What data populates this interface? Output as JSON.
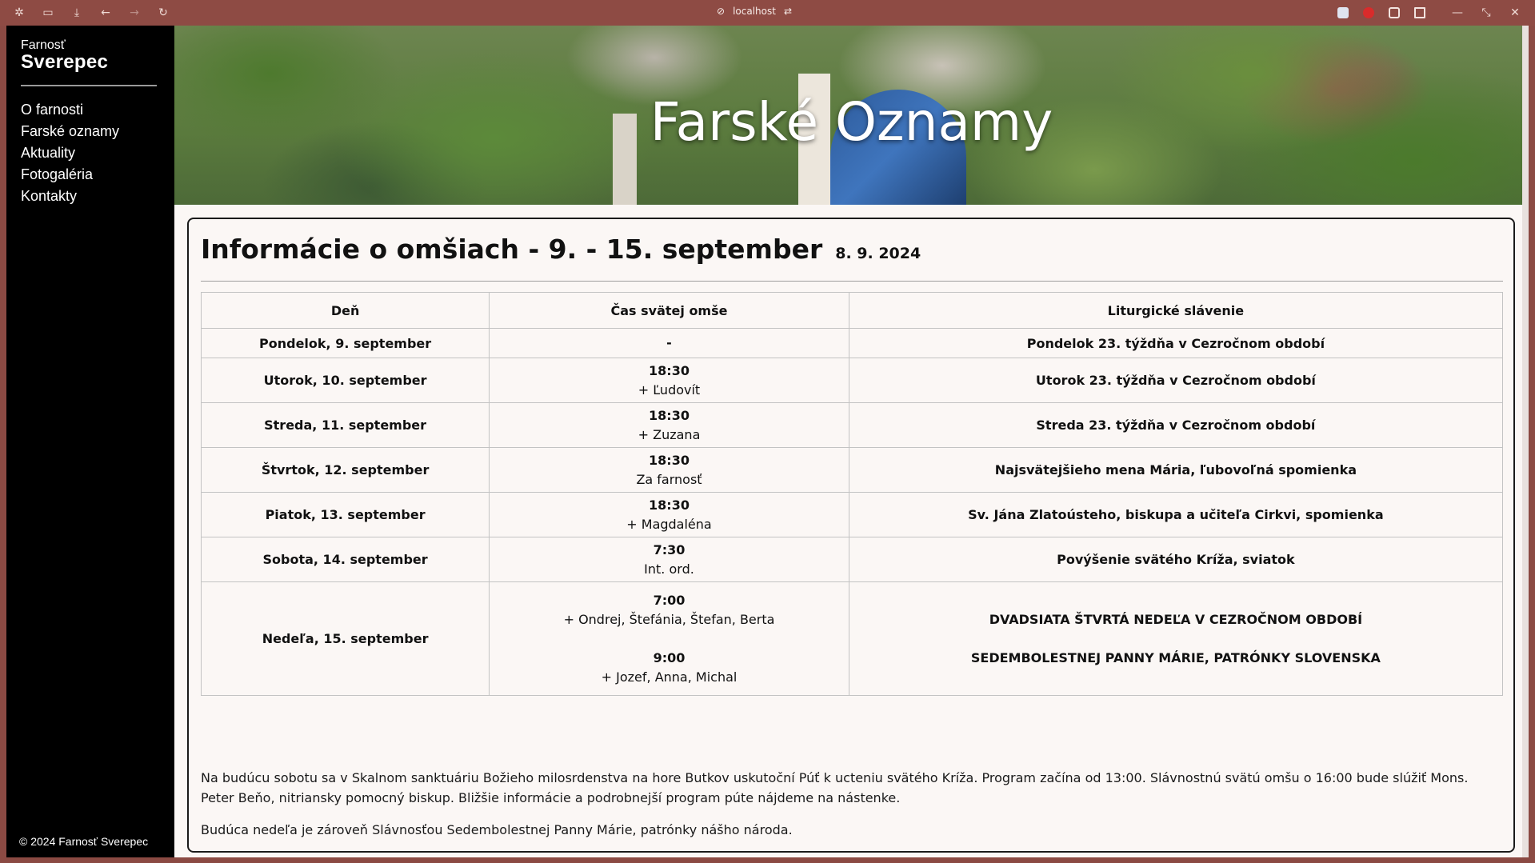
{
  "browser": {
    "url": "localhost"
  },
  "sidebar": {
    "brand_small": "Farnosť",
    "brand_big": "Sverepec",
    "nav": [
      "O farnosti",
      "Farské oznamy",
      "Aktuality",
      "Fotogaléria",
      "Kontakty"
    ],
    "copyright": "© 2024 Farnosť Sverepec"
  },
  "hero": {
    "title": "Farské Oznamy"
  },
  "content": {
    "title": "Informácie o omšiach - 9. - 15. september",
    "date": "8. 9. 2024",
    "table": {
      "headers": [
        "Deň",
        "Čas svätej omše",
        "Liturgické slávenie"
      ],
      "rows": [
        {
          "day": "Pondelok, 9. september",
          "masses": [
            {
              "time": "-",
              "intention": ""
            }
          ],
          "liturgy": [
            "Pondelok 23. týždňa v Cezročnom období"
          ]
        },
        {
          "day": "Utorok, 10. september",
          "masses": [
            {
              "time": "18:30",
              "intention": "+ Ľudovít"
            }
          ],
          "liturgy": [
            "Utorok 23. týždňa v Cezročnom období"
          ]
        },
        {
          "day": "Streda, 11. september",
          "masses": [
            {
              "time": "18:30",
              "intention": "+ Zuzana"
            }
          ],
          "liturgy": [
            "Streda 23. týždňa v Cezročnom období"
          ]
        },
        {
          "day": "Štvrtok, 12. september",
          "masses": [
            {
              "time": "18:30",
              "intention": "Za farnosť"
            }
          ],
          "liturgy": [
            "Najsvätejšieho mena Mária, ľubovoľná spomienka"
          ]
        },
        {
          "day": "Piatok, 13. september",
          "masses": [
            {
              "time": "18:30",
              "intention": "+ Magdaléna"
            }
          ],
          "liturgy": [
            "Sv. Jána Zlatoústeho, biskupa a učiteľa Cirkvi, spomienka"
          ]
        },
        {
          "day": "Sobota, 14. september",
          "masses": [
            {
              "time": "7:30",
              "intention": "Int. ord."
            }
          ],
          "liturgy": [
            "Povýšenie svätého Kríža, sviatok"
          ]
        },
        {
          "day": "Nedeľa, 15. september",
          "masses": [
            {
              "time": "7:00",
              "intention": "+ Ondrej, Štefánia, Štefan, Berta"
            },
            {
              "time": "9:00",
              "intention": "+ Jozef, Anna, Michal"
            }
          ],
          "liturgy": [
            "DVADSIATA ŠTVRTÁ NEDEĽA V CEZROČNOM OBDOBÍ",
            "SEDEMBOLESTNEJ PANNY MÁRIE, PATRÓNKY SLOVENSKA"
          ]
        }
      ]
    },
    "notes": [
      "Na budúcu sobotu sa v Skalnom sanktuáriu Božieho milosrdenstva na hore Butkov uskutoční Púť k ucteniu svätého Kríža. Program začína od 13:00. Slávnostnú svätú omšu o 16:00 bude slúžiť Mons. Peter Beňo, nitriansky pomocný biskup. Bližšie informácie a podrobnejší program púte nájdeme na nástenke.",
      "Budúca nedeľa je zároveň Slávnosťou Sedembolestnej Panny Márie, patrónky nášho národa."
    ]
  },
  "icons": {
    "chrome": [
      "settings-icon",
      "sidebar-icon",
      "download-icon",
      "back-icon",
      "forward-icon",
      "reload-icon",
      "link-icon",
      "share-icon",
      "minimize-icon",
      "restore-icon",
      "close-icon"
    ]
  }
}
